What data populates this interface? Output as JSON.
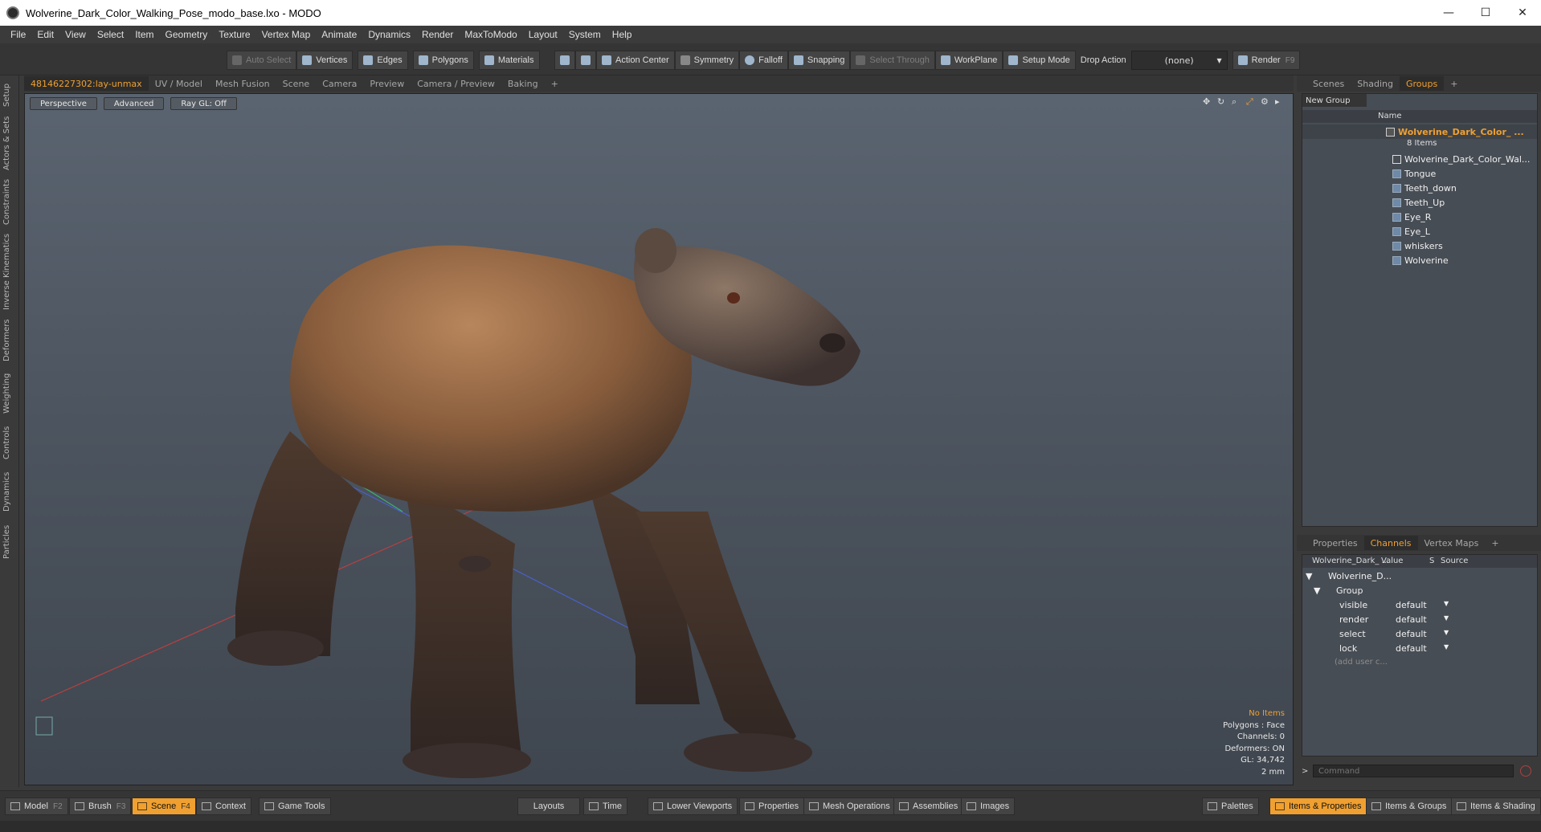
{
  "window": {
    "title": "Wolverine_Dark_Color_Walking_Pose_modo_base.lxo - MODO",
    "minimize": "—",
    "maximize": "☐",
    "close": "✕"
  },
  "menu": [
    "File",
    "Edit",
    "View",
    "Select",
    "Item",
    "Geometry",
    "Texture",
    "Vertex Map",
    "Animate",
    "Dynamics",
    "Render",
    "MaxToModo",
    "Layout",
    "System",
    "Help"
  ],
  "toolbar": {
    "auto_select": "Auto Select",
    "vertices": "Vertices",
    "edges": "Edges",
    "polygons": "Polygons",
    "materials": "Materials",
    "action_center": "Action Center",
    "symmetry": "Symmetry",
    "falloff": "Falloff",
    "snapping": "Snapping",
    "select_through": "Select Through",
    "workplane": "WorkPlane",
    "setup_mode": "Setup Mode",
    "drop_action_label": "Drop Action",
    "drop_action_value": "(none)",
    "render": "Render",
    "render_key": "F9"
  },
  "left_rail": [
    "Setup",
    "Actors & Sets",
    "Constraints",
    "Inverse Kinematics",
    "Deformers",
    "Weighting",
    "Controls",
    "Dynamics",
    "Particles"
  ],
  "viewport_tabs": [
    "48146227302:lay-unmax",
    "UV / Model",
    "Mesh Fusion",
    "Scene",
    "Camera",
    "Preview",
    "Camera / Preview",
    "Baking",
    "+"
  ],
  "viewport": {
    "perspective": "Perspective",
    "advanced": "Advanced",
    "raygl": "Ray GL: Off",
    "info": {
      "items": "No Items",
      "polygons": "Polygons : Face",
      "channels": "Channels: 0",
      "deformers": "Deformers: ON",
      "gl": "GL: 34,742",
      "units": "2 mm"
    }
  },
  "right_panel": {
    "top_tabs": [
      "Scenes",
      "Shading",
      "Groups",
      "+"
    ],
    "new_group": "New Group",
    "name_col": "Name",
    "group_name": "Wolverine_Dark_Color_ ...",
    "group_count": "8 Items",
    "group_items": [
      "Wolverine_Dark_Color_Wal...",
      "Tongue",
      "Teeth_down",
      "Teeth_Up",
      "Eye_R",
      "Eye_L",
      "whiskers",
      "Wolverine"
    ],
    "bottom_tabs": [
      "Properties",
      "Channels",
      "Vertex Maps",
      "+"
    ],
    "channels": {
      "col_name": "Wolverine_Dark_ ...",
      "col_value": "Value",
      "col_s": "S",
      "col_source": "Source",
      "item": "Wolverine_D...",
      "group": "Group",
      "rows": [
        {
          "name": "visible",
          "value": "default"
        },
        {
          "name": "render",
          "value": "default"
        },
        {
          "name": "select",
          "value": "default"
        },
        {
          "name": "lock",
          "value": "default"
        }
      ],
      "add_user": "(add user c..."
    },
    "command_placeholder": "Command"
  },
  "bottom_bar": {
    "model": "Model",
    "model_key": "F2",
    "brush": "Brush",
    "brush_key": "F3",
    "scene": "Scene",
    "scene_key": "F4",
    "context": "Context",
    "game_tools": "Game Tools",
    "layouts": "Layouts",
    "time": "Time",
    "lower_viewports": "Lower Viewports",
    "properties": "Properties",
    "mesh_operations": "Mesh Operations",
    "assemblies": "Assemblies",
    "images": "Images",
    "palettes": "Palettes",
    "items_properties": "Items & Properties",
    "items_groups": "Items & Groups",
    "items_shading": "Items & Shading"
  },
  "colors": {
    "accent": "#f0a030",
    "panel": "#3a3a3a",
    "viewport_top": "#5a6470"
  }
}
